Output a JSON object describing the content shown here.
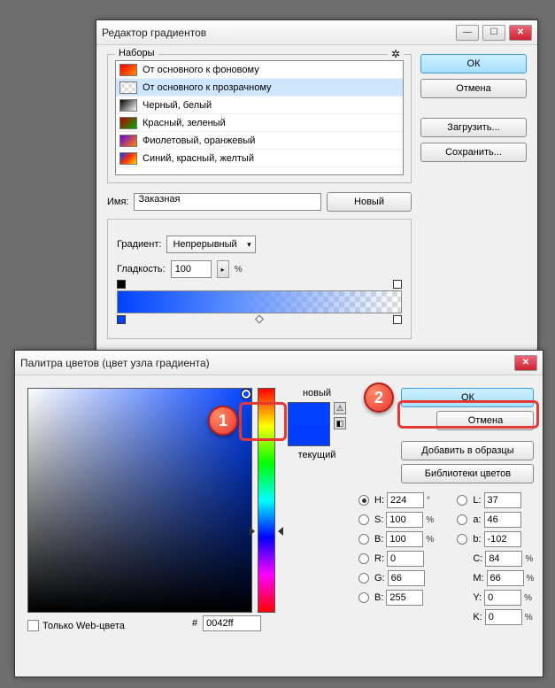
{
  "gradient_window": {
    "title": "Редактор градиентов",
    "presets_label": "Наборы",
    "presets": [
      {
        "label": "От основного к фоновому",
        "colors": "linear-gradient(135deg,#f00,#ff8c00)"
      },
      {
        "label": "От основного к прозрачному",
        "colors": "repeating-conic-gradient(#ddd 0 25%, #fff 0 50%) 50%/8px 8px"
      },
      {
        "label": "Черный, белый",
        "colors": "linear-gradient(135deg,#000,#fff)"
      },
      {
        "label": "Красный, зеленый",
        "colors": "linear-gradient(135deg,#b00,#0a0)"
      },
      {
        "label": "Фиолетовый, оранжевый",
        "colors": "linear-gradient(135deg,#60d,#f80)"
      },
      {
        "label": "Синий, красный, желтый",
        "colors": "linear-gradient(135deg,#13f,#f30,#fd0)"
      }
    ],
    "buttons": {
      "ok": "ОК",
      "cancel": "Отмена",
      "load": "Загрузить...",
      "save": "Сохранить..."
    },
    "name_label": "Имя:",
    "name_value": "Заказная",
    "new_btn": "Новый",
    "gradient_type_label": "Градиент:",
    "gradient_type_value": "Непрерывный",
    "smoothness_label": "Гладкость:",
    "smoothness_value": "100",
    "smoothness_unit": "%"
  },
  "color_window": {
    "title": "Палитра цветов (цвет узла градиента)",
    "new_label": "новый",
    "current_label": "текущий",
    "buttons": {
      "ok": "ОК",
      "cancel": "Отмена",
      "add": "Добавить в образцы",
      "libs": "Библиотеки цветов"
    },
    "webonly_label": "Только Web-цвета",
    "hsb": {
      "h": "224",
      "h_unit": "°",
      "s": "100",
      "s_unit": "%",
      "b": "100",
      "b_unit": "%"
    },
    "rgb": {
      "r": "0",
      "g": "66",
      "b": "255"
    },
    "lab": {
      "l": "37",
      "a": "46",
      "b": "-102"
    },
    "cmyk": {
      "c": "84",
      "m": "66",
      "y": "0",
      "k": "0",
      "unit": "%"
    },
    "hex_label": "#",
    "hex_value": "0042ff",
    "labels": {
      "H": "H:",
      "S": "S:",
      "B": "B:",
      "R": "R:",
      "G": "G:",
      "Bb": "B:",
      "L": "L:",
      "a": "a:",
      "b": "b:",
      "C": "C:",
      "M": "M:",
      "Y": "Y:",
      "K": "K:"
    }
  },
  "callouts": {
    "one": "1",
    "two": "2"
  }
}
